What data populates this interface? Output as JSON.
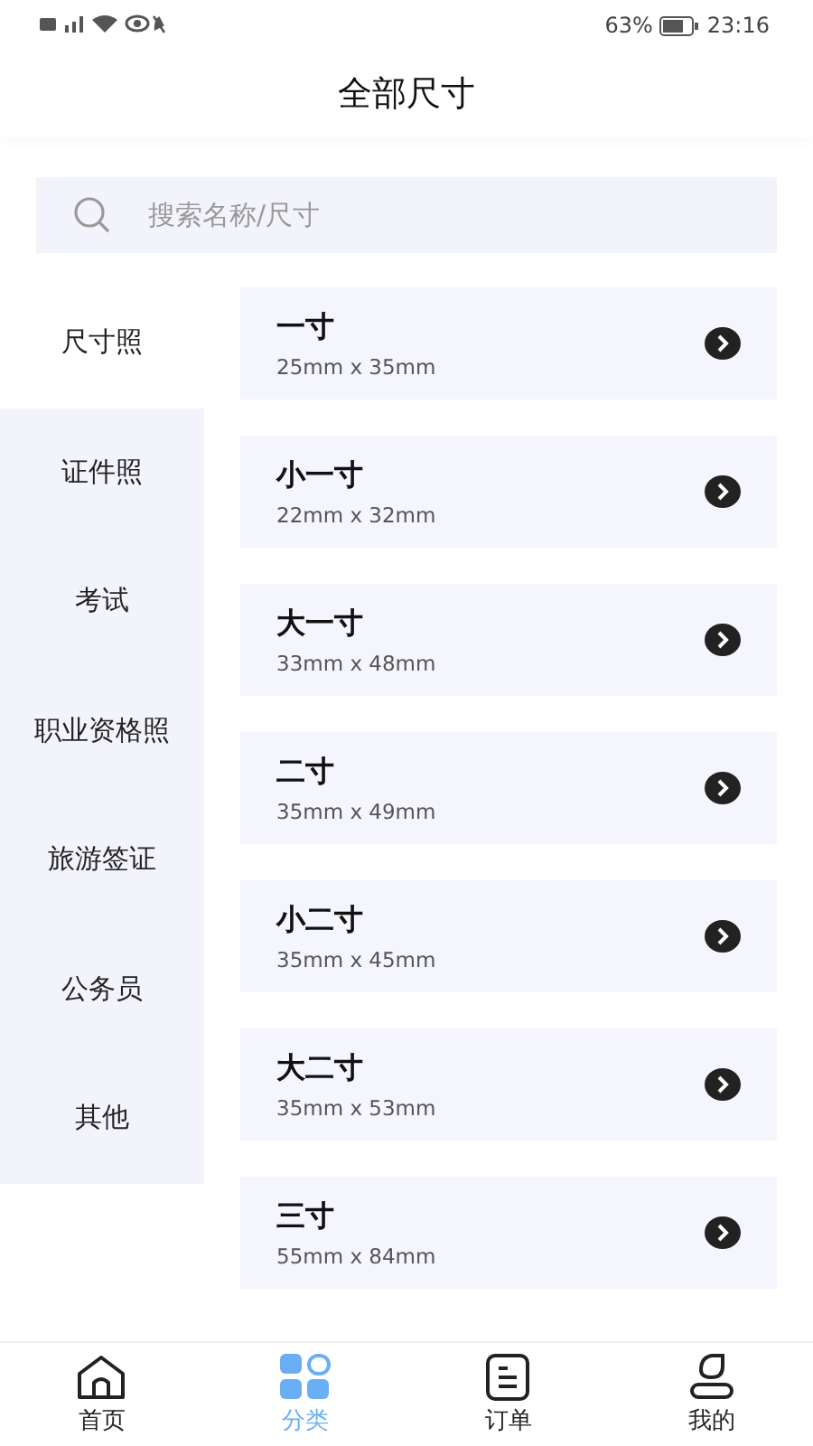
{
  "status_bar": {
    "battery_text": "63%",
    "time": "23:16"
  },
  "header": {
    "title": "全部尺寸"
  },
  "search": {
    "placeholder": "搜索名称/尺寸"
  },
  "sidebar": {
    "items": [
      {
        "label": "尺寸照",
        "selected": true
      },
      {
        "label": "证件照",
        "selected": false
      },
      {
        "label": "考试",
        "selected": false
      },
      {
        "label": "职业资格照",
        "selected": false
      },
      {
        "label": "旅游签证",
        "selected": false
      },
      {
        "label": "公务员",
        "selected": false
      },
      {
        "label": "其他",
        "selected": false
      }
    ]
  },
  "sizes": [
    {
      "name": "一寸",
      "dimensions": "25mm x 35mm"
    },
    {
      "name": "小一寸",
      "dimensions": "22mm x 32mm"
    },
    {
      "name": "大一寸",
      "dimensions": "33mm x 48mm"
    },
    {
      "name": "二寸",
      "dimensions": "35mm x 49mm"
    },
    {
      "name": "小二寸",
      "dimensions": "35mm x 45mm"
    },
    {
      "name": "大二寸",
      "dimensions": "35mm x 53mm"
    },
    {
      "name": "三寸",
      "dimensions": "55mm x 84mm"
    }
  ],
  "tab_bar": [
    {
      "label": "首页",
      "kind": "home",
      "selected": false
    },
    {
      "label": "分类",
      "kind": "category",
      "selected": true
    },
    {
      "label": "订单",
      "kind": "orders",
      "selected": false
    },
    {
      "label": "我的",
      "kind": "profile",
      "selected": false
    }
  ]
}
